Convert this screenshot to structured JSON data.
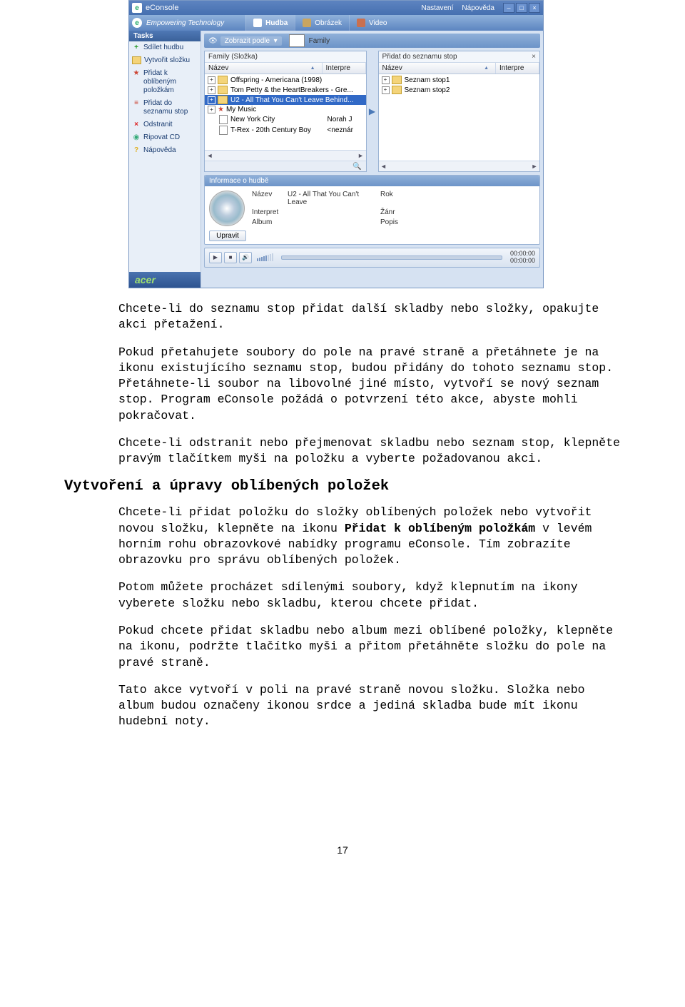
{
  "window": {
    "title": "eConsole",
    "menu": {
      "settings": "Nastavení",
      "help": "Nápověda"
    }
  },
  "ribbon": {
    "brand": "Empowering Technology",
    "tabs": [
      {
        "icon": "note",
        "label": "Hudba",
        "active": true
      },
      {
        "icon": "image",
        "label": "Obrázek",
        "active": false
      },
      {
        "icon": "video",
        "label": "Video",
        "active": false
      }
    ]
  },
  "sidebar": {
    "header": "Tasks",
    "items": [
      {
        "icon": "plus",
        "color": "#2a9b2a",
        "label": "Sdílet hudbu"
      },
      {
        "icon": "folder",
        "color": "#d8a330",
        "label": "Vytvořit složku"
      },
      {
        "icon": "star",
        "color": "#c43",
        "label": "Přidat k oblíbeným položkám"
      },
      {
        "icon": "list",
        "color": "#c43",
        "label": "Přidat do seznamu stop"
      },
      {
        "icon": "x",
        "color": "#d22",
        "label": "Odstranit"
      },
      {
        "icon": "cd",
        "color": "#3a7",
        "label": "Ripovat CD"
      },
      {
        "icon": "q",
        "color": "#e0b020",
        "label": "Nápověda"
      }
    ],
    "footer": "acer"
  },
  "toolbar": {
    "viewby_label": "Zobrazit podle",
    "family_label": "Family"
  },
  "panes": {
    "left": {
      "title": "Family (Složka)",
      "columns": {
        "name": "Název",
        "artist": "Interpre"
      },
      "rows": [
        {
          "type": "folder",
          "exp": "+",
          "label": "Offspring - Americana (1998)",
          "val": ""
        },
        {
          "type": "folder",
          "exp": "+",
          "label": "Tom Petty & the HeartBreakers - Gre...",
          "val": ""
        },
        {
          "type": "folder",
          "exp": "+",
          "label": "U2 - All That You Can't Leave Behind...",
          "val": "",
          "selected": true
        },
        {
          "type": "folder",
          "exp": "+",
          "label": "My Music",
          "val": "",
          "star": true
        },
        {
          "type": "file",
          "indent": true,
          "label": "New York City",
          "val": "Norah J"
        },
        {
          "type": "file",
          "indent": true,
          "label": "T-Rex - 20th Century Boy",
          "val": "<neznár"
        }
      ]
    },
    "right": {
      "title": "Přidat do seznamu stop",
      "columns": {
        "name": "Název",
        "artist": "Interpre"
      },
      "rows": [
        {
          "type": "folder",
          "exp": "+",
          "label": "Seznam stop1",
          "val": ""
        },
        {
          "type": "folder",
          "exp": "+",
          "label": "Seznam stop2",
          "val": ""
        }
      ]
    }
  },
  "info": {
    "header": "Informace o hudbě",
    "fields": {
      "name_lbl": "Název",
      "name_val": "U2 - All That You Can't Leave",
      "artist_lbl": "Interpret",
      "artist_val": "",
      "album_lbl": "Album",
      "album_val": "",
      "year_lbl": "Rok",
      "year_val": "",
      "genre_lbl": "Žánr",
      "genre_val": "",
      "desc_lbl": "Popis",
      "desc_val": ""
    },
    "edit_btn": "Upravit"
  },
  "player": {
    "time1": "00:00:00",
    "time2": "00:00:00"
  },
  "text": {
    "p1": "Chcete-li do seznamu stop přidat další skladby nebo složky, opakujte akci přetažení.",
    "p2": "Pokud přetahujete soubory do pole na pravé straně a přetáhnete je na ikonu existujícího seznamu stop, budou přidány do tohoto seznamu stop. Přetáhnete-li soubor na libovolné jiné místo, vytvoří se nový seznam stop. Program eConsole požádá o potvrzení této akce, abyste mohli pokračovat.",
    "p3": "Chcete-li odstranit nebo přejmenovat skladbu nebo seznam stop, klepněte pravým tlačítkem myši na položku a vyberte požadovanou akci.",
    "h1": "Vytvoření a úpravy oblíbených položek",
    "p4a": "Chcete-li přidat položku do složky oblíbených položek nebo vytvořit novou složku, klepněte na ikonu ",
    "p4b": "Přidat k oblíbeným položkám",
    "p4c": " v levém horním rohu obrazovkové nabídky programu eConsole. Tím zobrazíte obrazovku pro správu oblíbených položek.",
    "p5": "Potom můžete procházet sdílenými soubory, když klepnutím na ikony vyberete složku nebo skladbu, kterou chcete přidat.",
    "p6": "Pokud chcete přidat skladbu nebo album mezi oblíbené položky, klepněte na ikonu, podržte tlačítko myši a přitom přetáhněte složku do pole na pravé straně.",
    "p7": "Tato akce vytvoří v poli na pravé straně novou složku. Složka nebo album budou označeny ikonou srdce a jediná skladba bude mít ikonu hudební noty.",
    "page": "17"
  }
}
